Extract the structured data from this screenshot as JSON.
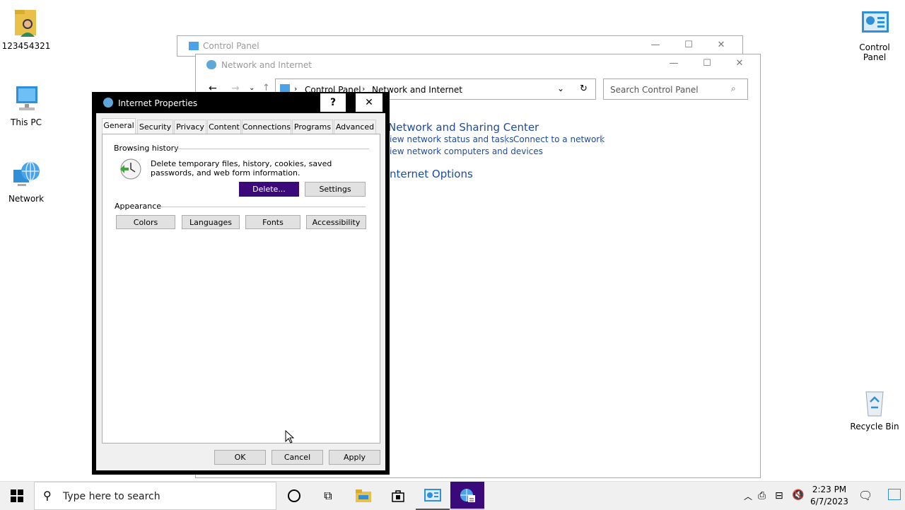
{
  "desktop": {
    "icons": [
      {
        "label": "123454321",
        "icon": "user-folder-icon"
      },
      {
        "label": "This PC",
        "icon": "computer-icon"
      },
      {
        "label": "Network",
        "icon": "network-globe-icon"
      },
      {
        "label": "Control Panel",
        "icon": "control-panel-icon"
      },
      {
        "label": "Recycle Bin",
        "icon": "recycle-bin-icon"
      }
    ]
  },
  "back_window": {
    "title": "Control Panel"
  },
  "cp_window": {
    "title": "Network and Internet",
    "breadcrumb": [
      "Control Panel",
      "Network and Internet"
    ],
    "search_placeholder": "Search Control Panel",
    "sections": {
      "nsc_title": "Network and Sharing Center",
      "nsc_link1": "iew network status and tasks",
      "nsc_link2": "Connect to a network",
      "nsc_link3": "iew network computers and devices",
      "io_title": "nternet Options"
    }
  },
  "dialog": {
    "title": "Internet Properties",
    "help": "?",
    "close": "✕",
    "tabs": [
      "General",
      "Security",
      "Privacy",
      "Content",
      "Connections",
      "Programs",
      "Advanced"
    ],
    "browsing_history": {
      "label": "Browsing history",
      "text": "Delete temporary files, history, cookies, saved passwords, and web form information.",
      "delete": "Delete...",
      "settings": "Settings"
    },
    "appearance": {
      "label": "Appearance",
      "buttons": [
        "Colors",
        "Languages",
        "Fonts",
        "Accessibility"
      ]
    },
    "footer": {
      "ok": "OK",
      "cancel": "Cancel",
      "apply": "Apply"
    }
  },
  "taskbar": {
    "search_placeholder": "Type here to search",
    "time": "2:23 PM",
    "date": "6/7/2023"
  },
  "colors": {
    "accent_purple": "#3b0a7a",
    "link_blue": "#1e4b9c"
  }
}
